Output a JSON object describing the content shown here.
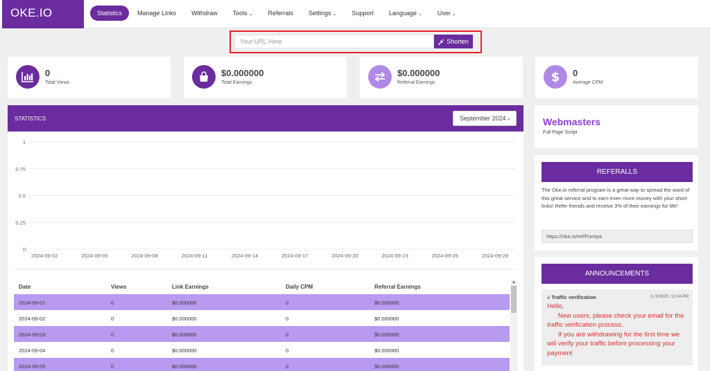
{
  "brand": "OKE.IO",
  "nav": [
    {
      "label": "Statistics",
      "active": true,
      "dropdown": false
    },
    {
      "label": "Manage Links",
      "active": false,
      "dropdown": false
    },
    {
      "label": "Withdraw",
      "active": false,
      "dropdown": false
    },
    {
      "label": "Tools",
      "active": false,
      "dropdown": true
    },
    {
      "label": "Referrals",
      "active": false,
      "dropdown": false
    },
    {
      "label": "Settings",
      "active": false,
      "dropdown": true
    },
    {
      "label": "Support",
      "active": false,
      "dropdown": false
    },
    {
      "label": "Language",
      "active": false,
      "dropdown": true
    },
    {
      "label": "User",
      "active": false,
      "dropdown": true
    }
  ],
  "shorten": {
    "placeholder": "Your URL Here",
    "button": "Shorten"
  },
  "stats": [
    {
      "value": "0",
      "label": "Total Views",
      "icon": "bar-chart-icon"
    },
    {
      "value": "$0.000000",
      "label": "Total Earnings",
      "icon": "shopping-bag-icon"
    },
    {
      "value": "$0.000000",
      "label": "Referral Earnings",
      "icon": "exchange-arrows-icon"
    },
    {
      "value": "0",
      "label": "Average CPM",
      "icon": "dollar-icon"
    }
  ],
  "statistics": {
    "title": "STATISTICS",
    "month": "September 2024"
  },
  "chart_data": {
    "type": "line",
    "x": [
      "2024-09-02",
      "2024-09-05",
      "2024-09-08",
      "2024-09-11",
      "2024-09-14",
      "2024-09-17",
      "2024-09-20",
      "2024-09-23",
      "2024-09-26",
      "2024-09-29"
    ],
    "y_ticks": [
      "1",
      "0.75",
      "0.5",
      "0.25",
      "0"
    ],
    "ylim": [
      0,
      1
    ],
    "series": []
  },
  "table": {
    "headers": [
      "Date",
      "Views",
      "Link Earnings",
      "Daily CPM",
      "Referral Earnings"
    ],
    "rows": [
      [
        "2024-09-01",
        "0",
        "$0.000000",
        "0",
        "$0.000000"
      ],
      [
        "2024-09-02",
        "0",
        "$0.000000",
        "0",
        "$0.000000"
      ],
      [
        "2024-09-03",
        "0",
        "$0.000000",
        "0",
        "$0.000000"
      ],
      [
        "2024-09-04",
        "0",
        "$0.000000",
        "0",
        "$0.000000"
      ],
      [
        "2024-09-05",
        "0",
        "$0.000000",
        "0",
        "$0.000000"
      ]
    ]
  },
  "webmasters": {
    "title": "Webmasters",
    "subtitle": "Full Page Script"
  },
  "referrals": {
    "title": "REFERALLS",
    "text": "The Oke.io referral program is a great way to spread the word of this great service and to earn even more money with your short links! Refer friends and receive 3% of their earnings for life!",
    "link": "https://oke.io/ref/Fumiya"
  },
  "announcements": {
    "title": "ANNOUNCEMENTS",
    "item": {
      "title": "Traffic verification",
      "date": "3/29/20, 11:04 PM",
      "body": "Hello,\n      New users, please check your email for the traffic verification process.\n      If you are withdrawing for the first time we will verify your traffic before processing your payment"
    }
  },
  "colors": {
    "brand": "#6a2c9e",
    "row_highlight": "#b89af0",
    "announcement_text": "#d93030",
    "highlight_box": "#e8202a"
  }
}
